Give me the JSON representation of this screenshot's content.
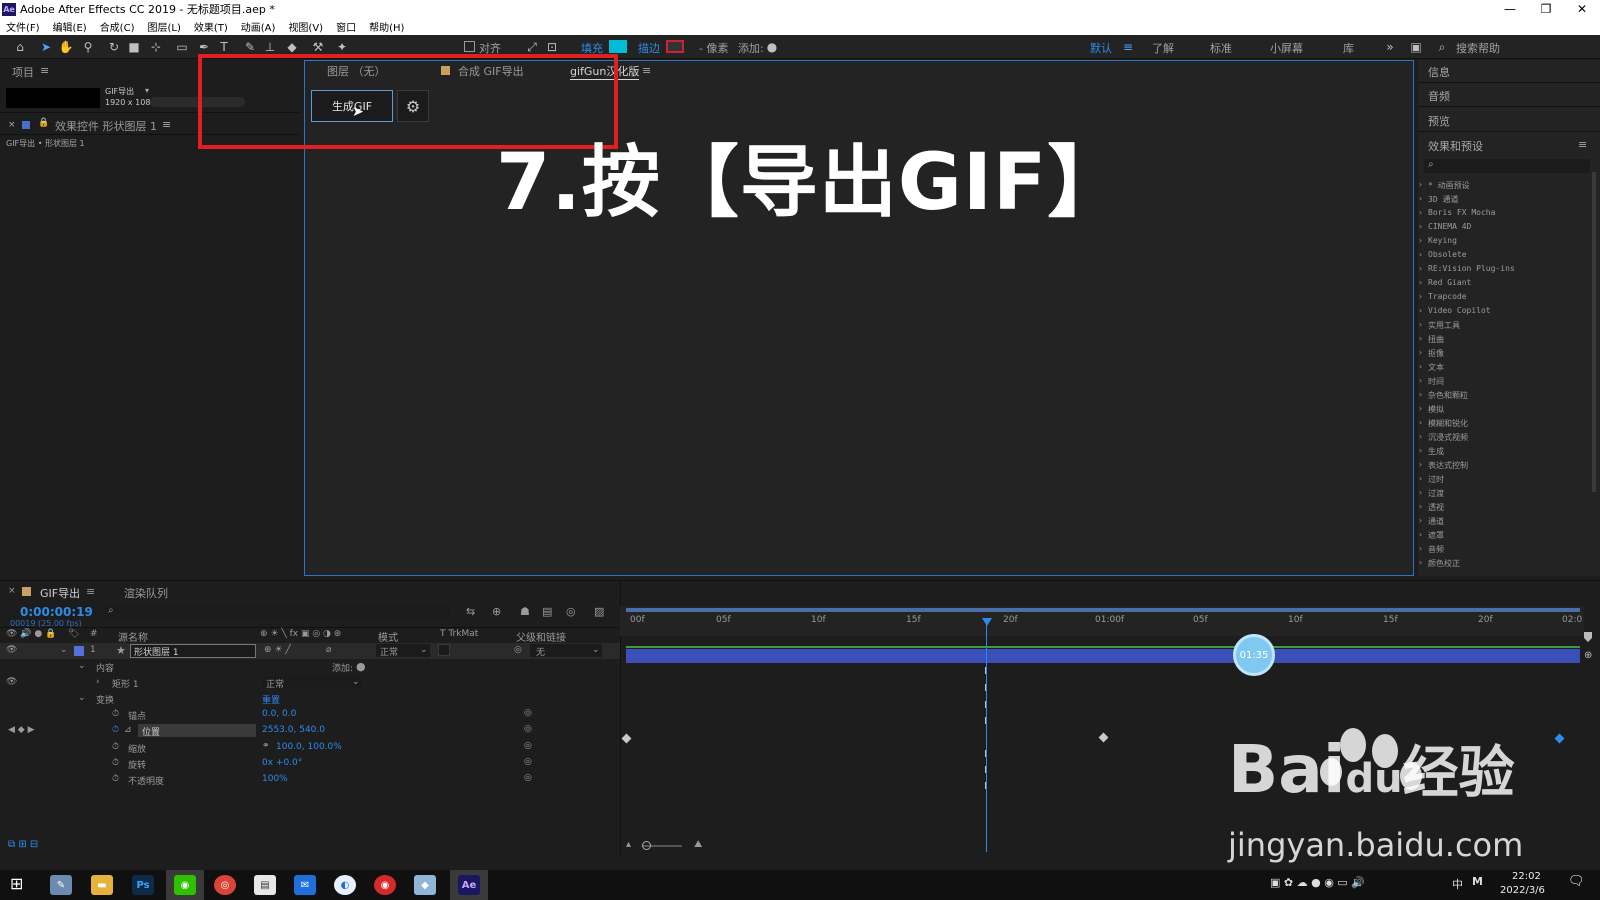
{
  "window": {
    "title": "Adobe After Effects CC 2019 - 无标题项目.aep *",
    "app_icon": "Ae",
    "controls": [
      "—",
      "❐",
      "✕"
    ]
  },
  "menu": [
    "文件(F)",
    "编辑(E)",
    "合成(C)",
    "图层(L)",
    "效果(T)",
    "动画(A)",
    "视图(V)",
    "窗口",
    "帮助(H)"
  ],
  "toolbar": {
    "align_label": "对齐",
    "fill_label": "填充",
    "stroke_label": "描边",
    "pixel_label": "- 像素",
    "add_label": "添加:",
    "workspaces": [
      "默认",
      "了解",
      "标准",
      "小屏幕",
      "库"
    ],
    "search_help": "搜索帮助",
    "fill_color": "#00bcd4"
  },
  "project_panel": {
    "tab": "项目",
    "comp_name": "GIF导出",
    "comp_size": "1920 x 108",
    "effects_tab": "效果控件 形状图层 1",
    "breadcrumb": "GIF导出 • 形状图层 1"
  },
  "comp_panel": {
    "tabs": [
      "图层 （无）",
      "合成 GIF导出",
      "gifGun汉化版"
    ],
    "generate_button": "生成GIF",
    "step_title": "7.按【导出GIF】"
  },
  "right_panel": {
    "sections": [
      "信息",
      "音频",
      "预览",
      "效果和预设"
    ],
    "effects": [
      "* 动画预设",
      "3D 通道",
      "Boris FX Mocha",
      "CINEMA 4D",
      "Keying",
      "Obsolete",
      "RE:Vision Plug-ins",
      "Red Giant",
      "Trapcode",
      "Video Copilot",
      "实用工具",
      "扭曲",
      "抠像",
      "文本",
      "时间",
      "杂色和颗粒",
      "模拟",
      "模糊和锐化",
      "沉浸式视频",
      "生成",
      "表达式控制",
      "过时",
      "过渡",
      "透视",
      "通道",
      "遮罩",
      "音频",
      "颜色校正"
    ]
  },
  "timeline": {
    "tab": "GIF导出",
    "render_queue": "渲染队列",
    "timecode": "0:00:00:19",
    "frame_info": "00019 (25.00 fps)",
    "col_source": "源名称",
    "col_mode": "模式",
    "col_trkmat": "T TrkMat",
    "col_parent": "父级和链接",
    "layer_num": "1",
    "layer_name": "形状图层 1",
    "layer_mode": "正常",
    "layer_parent": "无",
    "contents": "内容",
    "add": "添加:",
    "rect": "矩形 1",
    "rect_mode": "正常",
    "transform": "变换",
    "reset": "重置",
    "props": [
      {
        "name": "锚点",
        "value": "0.0, 0.0"
      },
      {
        "name": "位置",
        "value": "2553.0, 540.0"
      },
      {
        "name": "缩放",
        "value": "100.0, 100.0%"
      },
      {
        "name": "旋转",
        "value": "0x +0.0°"
      },
      {
        "name": "不透明度",
        "value": "100%"
      }
    ],
    "ruler": [
      "00f",
      "05f",
      "10f",
      "15f",
      "20f",
      "01:00f",
      "05f",
      "10f",
      "15f",
      "20f",
      "02:0"
    ],
    "bubble": "01:35"
  },
  "taskbar": {
    "time": "22:02",
    "date": "2022/3/6",
    "ime": "中"
  },
  "watermark": {
    "logo_text": "Bai",
    "logo_du": "du",
    "logo_cn": "经验",
    "url": "jingyan.baidu.com"
  }
}
